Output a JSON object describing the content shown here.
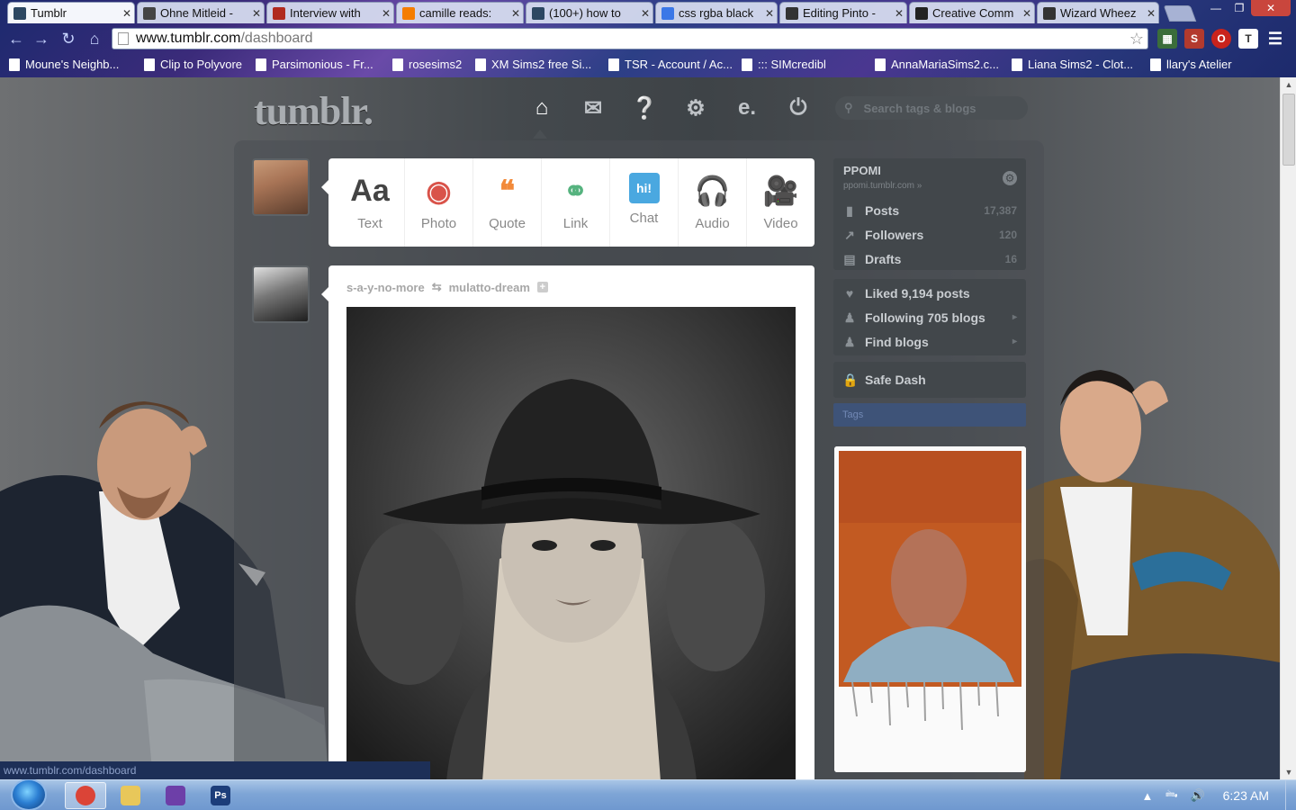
{
  "browser": {
    "tabs": [
      {
        "title": "Tumblr",
        "favicon": "tumblr-icon",
        "color": "#2c4762"
      },
      {
        "title": "Ohne Mitleid -",
        "favicon": "film-icon",
        "color": "#444444"
      },
      {
        "title": "Interview with",
        "favicon": "video-icon",
        "color": "#b02a1f"
      },
      {
        "title": "camille reads:",
        "favicon": "blogger-icon",
        "color": "#f57d00"
      },
      {
        "title": "(100+) how to",
        "favicon": "tumblr-icon",
        "color": "#2c4762"
      },
      {
        "title": "css rgba black",
        "favicon": "google-icon",
        "color": "#3b78e7"
      },
      {
        "title": "Editing Pinto -",
        "favicon": "wiki-icon",
        "color": "#333333"
      },
      {
        "title": "Creative Comm",
        "favicon": "cc-icon",
        "color": "#222222"
      },
      {
        "title": "Wizard Wheez",
        "favicon": "wiki-icon",
        "color": "#333333"
      }
    ],
    "url_domain": "www.tumblr.com",
    "url_path": "/dashboard",
    "bookmarks": [
      "Moune's Neighb...",
      "Clip to Polyvore",
      "Parsimonious - Fr...",
      "rosesims2",
      "XM Sims2 free Si...",
      "TSR - Account / Ac...",
      "::: SIMcredibl",
      "AnnaMariaSims2.c...",
      "Liana Sims2 - Clot...",
      "llary's Atelier"
    ],
    "status_url": "www.tumblr.com/dashboard"
  },
  "tumblr": {
    "logo": "tumblr.",
    "nav_icons": [
      "home-icon",
      "inbox-icon",
      "help-icon",
      "settings-icon",
      "activity-icon",
      "logout-icon"
    ],
    "search_placeholder": "Search tags & blogs",
    "post_types": [
      {
        "label": "Text",
        "icon": "Aa",
        "color": "#444444"
      },
      {
        "label": "Photo",
        "icon": "photo-icon",
        "color": "#d9534a"
      },
      {
        "label": "Quote",
        "icon": "quote-icon",
        "color": "#f28a3a"
      },
      {
        "label": "Link",
        "icon": "link-icon",
        "color": "#56b37f"
      },
      {
        "label": "Chat",
        "icon": "hi!",
        "color": "#4aa8e0"
      },
      {
        "label": "Audio",
        "icon": "audio-icon",
        "color": "#9b6fc9"
      },
      {
        "label": "Video",
        "icon": "video-icon",
        "color": "#7d8388"
      }
    ],
    "post": {
      "reblogger": "s-a-y-no-more",
      "source": "mulatto-dream"
    },
    "blog": {
      "name": "PPOMI",
      "url": "ppomi.tumblr.com »",
      "stats": [
        {
          "label": "Posts",
          "count": "17,387",
          "icon": "posts-icon"
        },
        {
          "label": "Followers",
          "count": "120",
          "icon": "followers-icon"
        },
        {
          "label": "Drafts",
          "count": "16",
          "icon": "drafts-icon"
        }
      ]
    },
    "sidebar_links": [
      {
        "label": "Liked 9,194 posts",
        "icon": "heart-icon",
        "arrow": ""
      },
      {
        "label": "Following 705 blogs",
        "icon": "person-icon",
        "arrow": "▸"
      },
      {
        "label": "Find blogs",
        "icon": "person-add-icon",
        "arrow": "▸"
      }
    ],
    "safe_dash": "Safe Dash",
    "tags_label": "Tags"
  },
  "taskbar": {
    "apps": [
      {
        "name": "chrome-icon",
        "color": "#db4437"
      },
      {
        "name": "explorer-icon",
        "color": "#e8c75a"
      },
      {
        "name": "media-icon",
        "color": "#6d3fa8"
      },
      {
        "name": "photoshop-icon",
        "color": "#1c3d7a",
        "text": "Ps"
      }
    ],
    "clock": "6:23 AM"
  }
}
